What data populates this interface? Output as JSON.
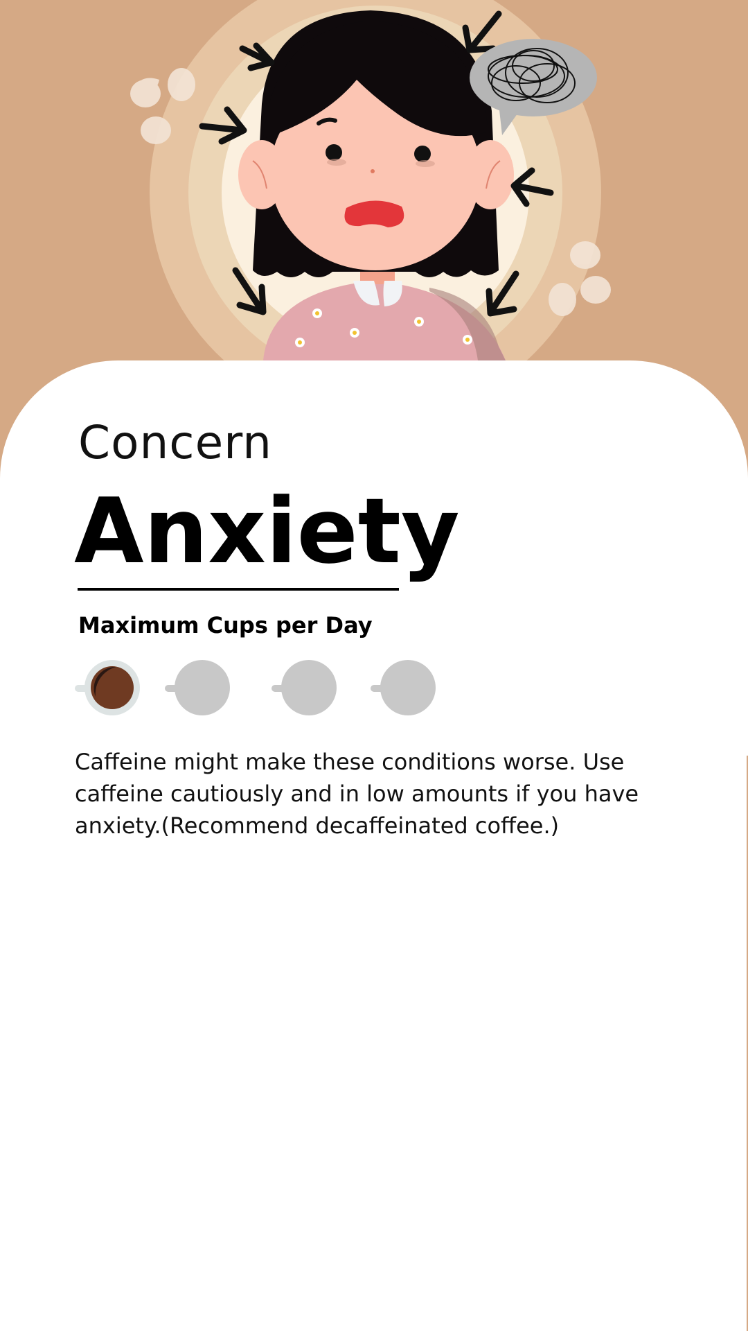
{
  "concern_label": "Concern",
  "condition_title": "Anxiety",
  "cups_heading": "Maximum Cups per Day",
  "cups": {
    "max": 4,
    "allowed": 1
  },
  "description": "Caffeine might make these conditions worse. Use caffeine cautiously and in low amounts if you have anxiety.(Recommend decaffeinated coffee.)",
  "colors": {
    "hero_background": "#d5a985",
    "filled_cup": "#6f3a22",
    "empty_cup": "#c8c8c8"
  },
  "icons": {
    "hero": "anxious-girl-illustration",
    "cup_filled": "coffee-cup-filled-icon",
    "cup_empty": "coffee-cup-empty-icon"
  }
}
